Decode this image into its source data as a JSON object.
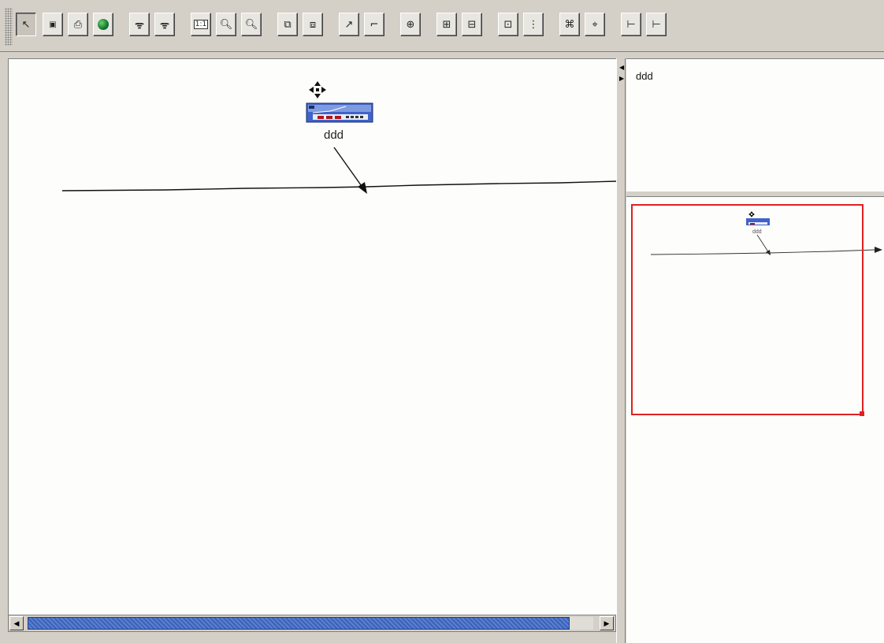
{
  "toolbar": {
    "buttons": [
      {
        "name": "select-tool-button",
        "icon": "pointer-arrow-icon",
        "glyph": "↖",
        "pressed": true
      },
      {
        "name": "save-button",
        "icon": "floppy-disk-icon",
        "glyph": "💾",
        "pressed": false
      },
      {
        "name": "print-button",
        "icon": "printer-icon",
        "glyph": "🖶",
        "pressed": false
      },
      {
        "name": "web-button",
        "icon": "globe-icon",
        "glyph": "◍",
        "pressed": false
      },
      {
        "name": "find-button",
        "icon": "binoculars-icon",
        "glyph": "⁂",
        "pressed": false
      },
      {
        "name": "find-next-button",
        "icon": "binoculars-arrow-icon",
        "glyph": "⁑",
        "pressed": false
      },
      {
        "name": "actual-size-button",
        "icon": "one-to-one-icon",
        "glyph": "1:1",
        "pressed": false
      },
      {
        "name": "zoom-in-button",
        "icon": "zoom-in-icon",
        "glyph": "⊕",
        "pressed": false
      },
      {
        "name": "zoom-out-button",
        "icon": "zoom-out-icon",
        "glyph": "⊖",
        "pressed": false
      },
      {
        "name": "fit-content-button",
        "icon": "fit-content-icon",
        "glyph": "⧉",
        "pressed": false
      },
      {
        "name": "fit-selection-button",
        "icon": "fit-selection-icon",
        "glyph": "⧈",
        "pressed": false
      },
      {
        "name": "link-tool-button",
        "icon": "diagonal-link-icon",
        "glyph": "↗",
        "pressed": false
      },
      {
        "name": "orthogonal-link-button",
        "icon": "orthogonal-link-icon",
        "glyph": "⌐",
        "pressed": false
      },
      {
        "name": "zoom-box-button",
        "icon": "zoom-box-icon",
        "glyph": "⊕",
        "pressed": false
      },
      {
        "name": "expand-group-button",
        "icon": "expand-group-icon",
        "glyph": "⊞",
        "pressed": false
      },
      {
        "name": "collapse-group-button",
        "icon": "collapse-group-icon",
        "glyph": "⊟",
        "pressed": false
      },
      {
        "name": "group-button",
        "icon": "group-icon",
        "glyph": "⊡",
        "pressed": false
      },
      {
        "name": "ungroup-button",
        "icon": "ungroup-icon",
        "glyph": "⋮",
        "pressed": false
      },
      {
        "name": "layout-button",
        "icon": "layout-star-icon",
        "glyph": "⌘",
        "pressed": false
      },
      {
        "name": "layout-alt-button",
        "icon": "layout-alt-icon",
        "glyph": "⌖",
        "pressed": false
      },
      {
        "name": "tree-layout-button",
        "icon": "tree-layout-icon",
        "glyph": "⊢",
        "pressed": false
      },
      {
        "name": "tree-layout-alt-button",
        "icon": "tree-layout-alt-icon",
        "glyph": "⊢",
        "pressed": false
      }
    ]
  },
  "canvas": {
    "node": {
      "label": "ddd",
      "icon": "network-device-icon",
      "move_icon": "move-cross-icon"
    }
  },
  "properties": {
    "title": "ddd"
  },
  "overview": {
    "node_label": "ddd",
    "viewport_color": "#e02020"
  },
  "colors": {
    "canvas_bg": "#fdfdfb",
    "chrome": "#d4d0c8",
    "scroll_thumb": "#3b63b8",
    "device_blue": "#3f63c9",
    "device_red": "#b0151b"
  }
}
